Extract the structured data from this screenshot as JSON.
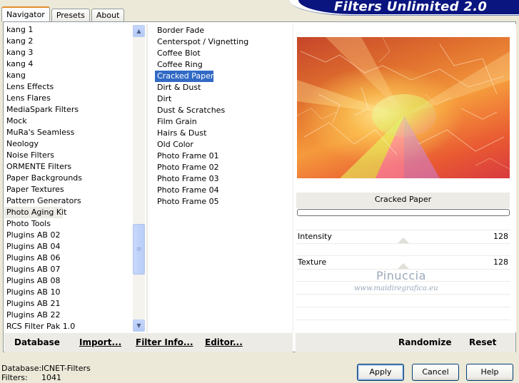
{
  "tabs": [
    "Navigator",
    "Presets",
    "About"
  ],
  "header": {
    "title": "Filters Unlimited 2.0"
  },
  "category_list": {
    "items": [
      "kang 1",
      "kang 2",
      "kang 3",
      "kang 4",
      "kang",
      "Lens Effects",
      "Lens Flares",
      "MediaSpark Filters",
      "Mock",
      "MuRa's Seamless",
      "Neology",
      "Noise Filters",
      "ORMENTE Filters",
      "Paper Backgrounds",
      "Paper Textures",
      "Pattern Generators",
      "Photo Aging Kit",
      "Photo Tools",
      "Plugins AB 02",
      "Plugins AB 04",
      "Plugins AB 06",
      "Plugins AB 07",
      "Plugins AB 08",
      "Plugins AB 10",
      "Plugins AB 21",
      "Plugins AB 22",
      "RCS Filter Pak 1.0"
    ],
    "selected": "Photo Aging Kit",
    "scroll_up_icon": "triangle-up-icon",
    "scroll_down_icon": "triangle-down-icon"
  },
  "filter_list": {
    "items": [
      "Border Fade",
      "Centerspot / Vignetting",
      "Coffee Blot",
      "Coffee Ring",
      "Cracked Paper",
      "Dirt & Dust",
      "Dirt",
      "Dust & Scratches",
      "Film Grain",
      "Hairs & Dust",
      "Old Color",
      "Photo Frame 01",
      "Photo Frame 02",
      "Photo Frame 03",
      "Photo Frame 04",
      "Photo Frame 05"
    ],
    "selected": "Cracked Paper"
  },
  "preview": {
    "caption": "Cracked Paper",
    "progress": 0
  },
  "sliders": [
    {
      "label": "Intensity",
      "value": "128"
    },
    {
      "label": "Texture",
      "value": "128"
    }
  ],
  "watermark": {
    "line1": "Pinuccia",
    "line2": "www.maidiregrafica.eu"
  },
  "toolbar": {
    "database": "Database",
    "import": "Import...",
    "filter_info": "Filter Info...",
    "editor": "Editor...",
    "randomize": "Randomize",
    "reset": "Reset"
  },
  "status": {
    "database_label": "Database:",
    "database_value": "ICNET-Filters",
    "filters_label": "Filters:",
    "filters_value": "1041"
  },
  "buttons": {
    "apply": "Apply",
    "cancel": "Cancel",
    "help": "Help"
  }
}
